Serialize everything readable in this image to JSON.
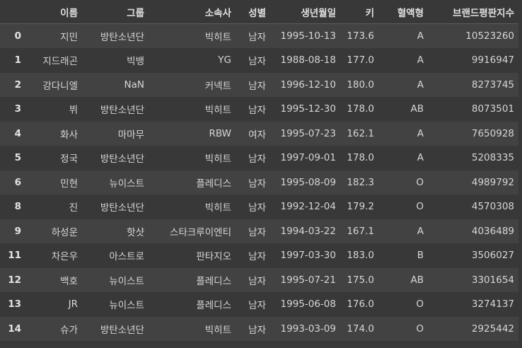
{
  "table": {
    "columns": [
      "",
      "이름",
      "그룹",
      "소속사",
      "성별",
      "생년월일",
      "키",
      "혈액형",
      "브랜드평판지수"
    ],
    "rows": [
      [
        "0",
        "지민",
        "방탄소년단",
        "빅히트",
        "남자",
        "1995-10-13",
        "173.6",
        "A",
        "10523260"
      ],
      [
        "1",
        "지드래곤",
        "빅뱅",
        "YG",
        "남자",
        "1988-08-18",
        "177.0",
        "A",
        "9916947"
      ],
      [
        "2",
        "강다니엘",
        "NaN",
        "커넥트",
        "남자",
        "1996-12-10",
        "180.0",
        "A",
        "8273745"
      ],
      [
        "3",
        "뷔",
        "방탄소년단",
        "빅히트",
        "남자",
        "1995-12-30",
        "178.0",
        "AB",
        "8073501"
      ],
      [
        "4",
        "화사",
        "마마무",
        "RBW",
        "여자",
        "1995-07-23",
        "162.1",
        "A",
        "7650928"
      ],
      [
        "5",
        "정국",
        "방탄소년단",
        "빅히트",
        "남자",
        "1997-09-01",
        "178.0",
        "A",
        "5208335"
      ],
      [
        "6",
        "민현",
        "뉴이스트",
        "플레디스",
        "남자",
        "1995-08-09",
        "182.3",
        "O",
        "4989792"
      ],
      [
        "8",
        "진",
        "방탄소년단",
        "빅히트",
        "남자",
        "1992-12-04",
        "179.2",
        "O",
        "4570308"
      ],
      [
        "9",
        "하성운",
        "핫샷",
        "스타크루이엔티",
        "남자",
        "1994-03-22",
        "167.1",
        "A",
        "4036489"
      ],
      [
        "11",
        "차은우",
        "아스트로",
        "판타지오",
        "남자",
        "1997-03-30",
        "183.0",
        "B",
        "3506027"
      ],
      [
        "12",
        "백호",
        "뉴이스트",
        "플레디스",
        "남자",
        "1995-07-21",
        "175.0",
        "AB",
        "3301654"
      ],
      [
        "13",
        "JR",
        "뉴이스트",
        "플레디스",
        "남자",
        "1995-06-08",
        "176.0",
        "O",
        "3274137"
      ],
      [
        "14",
        "슈가",
        "방탄소년단",
        "빅히트",
        "남자",
        "1993-03-09",
        "174.0",
        "O",
        "2925442"
      ]
    ]
  },
  "colors": {
    "background": "#383838",
    "row_stripe": "#424242",
    "text": "#d6d6d6"
  }
}
